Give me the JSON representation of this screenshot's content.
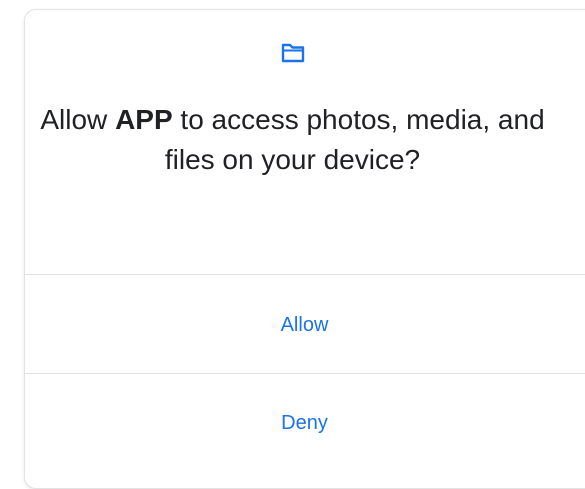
{
  "dialog": {
    "icon": "folder-icon",
    "message_prefix": "Allow ",
    "app_name": "APP",
    "message_suffix": " to access photos, media, and files on your device?",
    "allow_label": "Allow",
    "deny_label": "Deny"
  },
  "colors": {
    "accent": "#1a73e8",
    "text": "#202124",
    "divider": "#e0e0e0"
  }
}
